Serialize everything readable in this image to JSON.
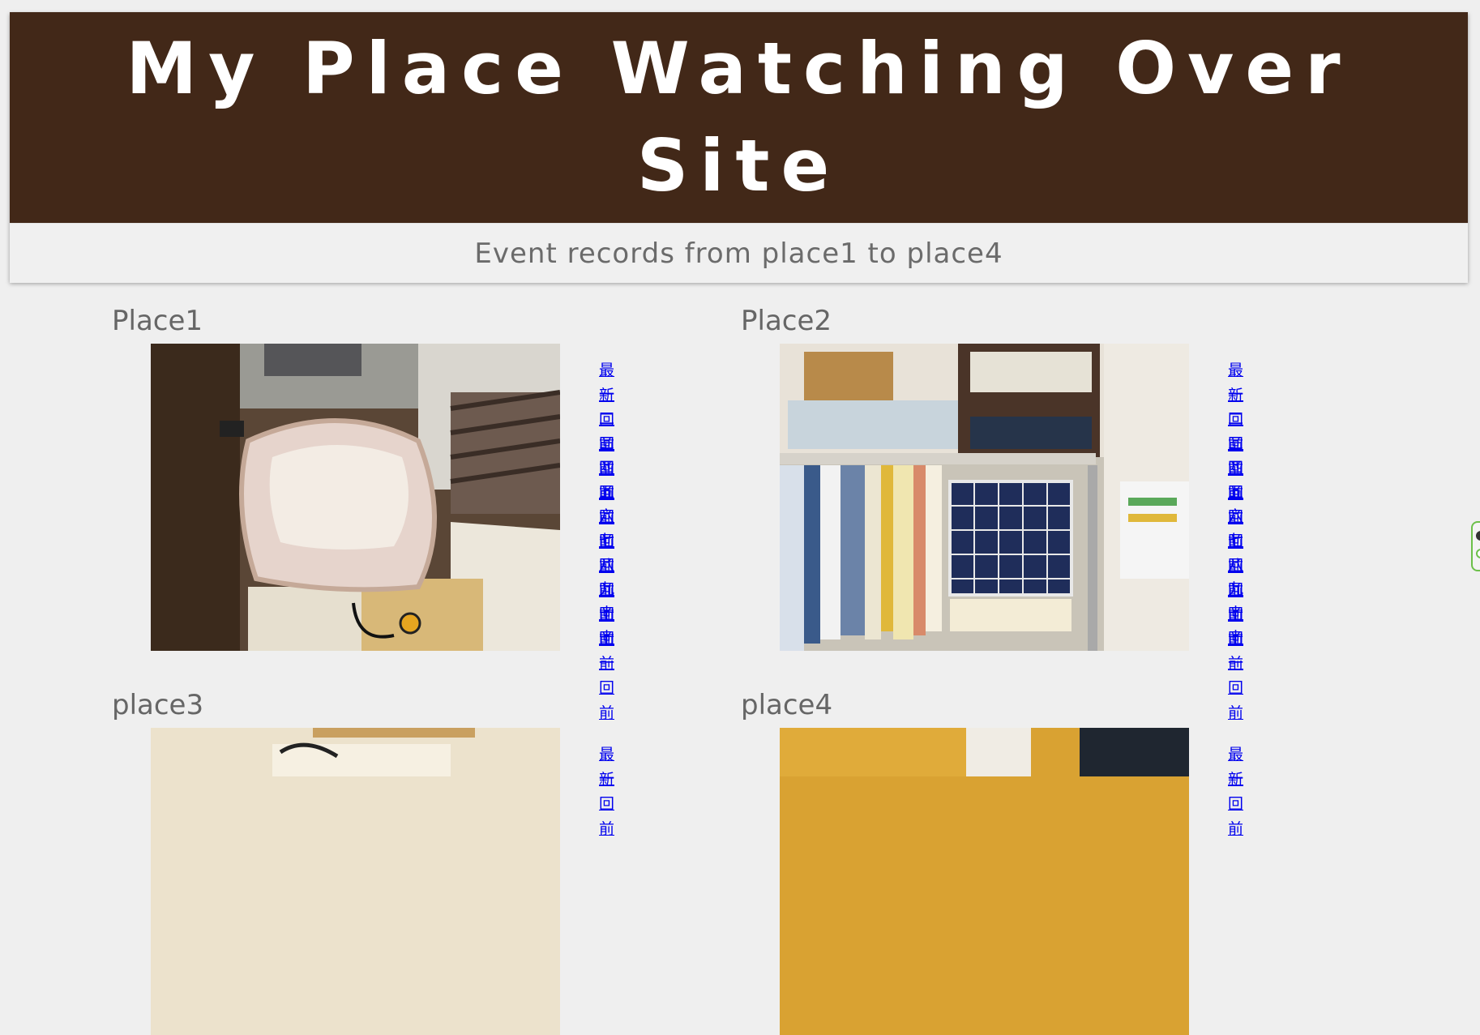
{
  "header": {
    "title": "My Place Watching Over Site",
    "subtitle": "Event records from place1 to place4"
  },
  "places": [
    {
      "name": "Place1",
      "links": [
        "最新",
        "一回前",
        "二回前",
        "三回前",
        "四回前",
        "五回前",
        "六回前",
        "七回前",
        "八回前",
        "九回前",
        "十回前",
        "十一回前"
      ]
    },
    {
      "name": "Place2",
      "links": [
        "最新",
        "一回前",
        "二回前",
        "三回前",
        "四回前",
        "五回前",
        "六回前",
        "七回前",
        "八回前",
        "九回前",
        "十回前",
        "十一回前"
      ]
    },
    {
      "name": "place3",
      "links": [
        "最新",
        "一回前"
      ]
    },
    {
      "name": "place4",
      "links": [
        "最新",
        "一回前"
      ]
    }
  ],
  "colors": {
    "banner": "#422818",
    "page_background": "#efefef",
    "link": "#0000ee",
    "heading": "#666666"
  }
}
